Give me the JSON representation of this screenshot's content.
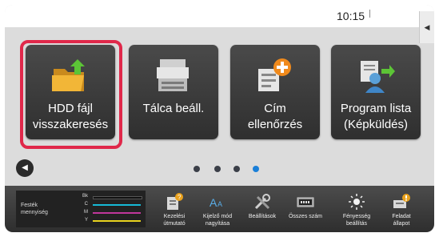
{
  "status_bar": {
    "clock": "10:15"
  },
  "tiles": [
    {
      "line1": "HDD fájl",
      "line2": "visszakeresés",
      "icon": "folder-upload-icon"
    },
    {
      "line1": "Tálca beáll.",
      "line2": "",
      "icon": "printer-icon"
    },
    {
      "line1": "Cím",
      "line2": "ellenőrzés",
      "icon": "address-add-icon"
    },
    {
      "line1": "Program lista",
      "line2": "(Képküldés)",
      "icon": "program-list-icon"
    }
  ],
  "pager": {
    "pages": 4,
    "active_page": 4,
    "active_color": "#1a7fd8"
  },
  "toner": {
    "title_line1": "Festék",
    "title_line2": "mennyiség",
    "rows": [
      {
        "name": "Bk",
        "color": "#111111"
      },
      {
        "name": "C",
        "color": "#16b9d6"
      },
      {
        "name": "M",
        "color": "#c0379c"
      },
      {
        "name": "Y",
        "color": "#e8d21e"
      }
    ]
  },
  "toolbar": [
    {
      "line1": "Kezelési",
      "line2": "útmutató",
      "icon": "manual-icon"
    },
    {
      "line1": "Kijelző mód",
      "line2": "nagyítása",
      "icon": "text-zoom-icon"
    },
    {
      "line1": "Beállítások",
      "line2": "",
      "icon": "tools-icon"
    },
    {
      "line1": "Összes szám",
      "line2": "",
      "icon": "counter-icon"
    },
    {
      "line1": "Fényesség",
      "line2": "beállítás",
      "icon": "brightness-icon"
    },
    {
      "line1": "Feladat",
      "line2": "állapot",
      "icon": "job-status-icon"
    }
  ],
  "accent_highlight": "#e0284a"
}
